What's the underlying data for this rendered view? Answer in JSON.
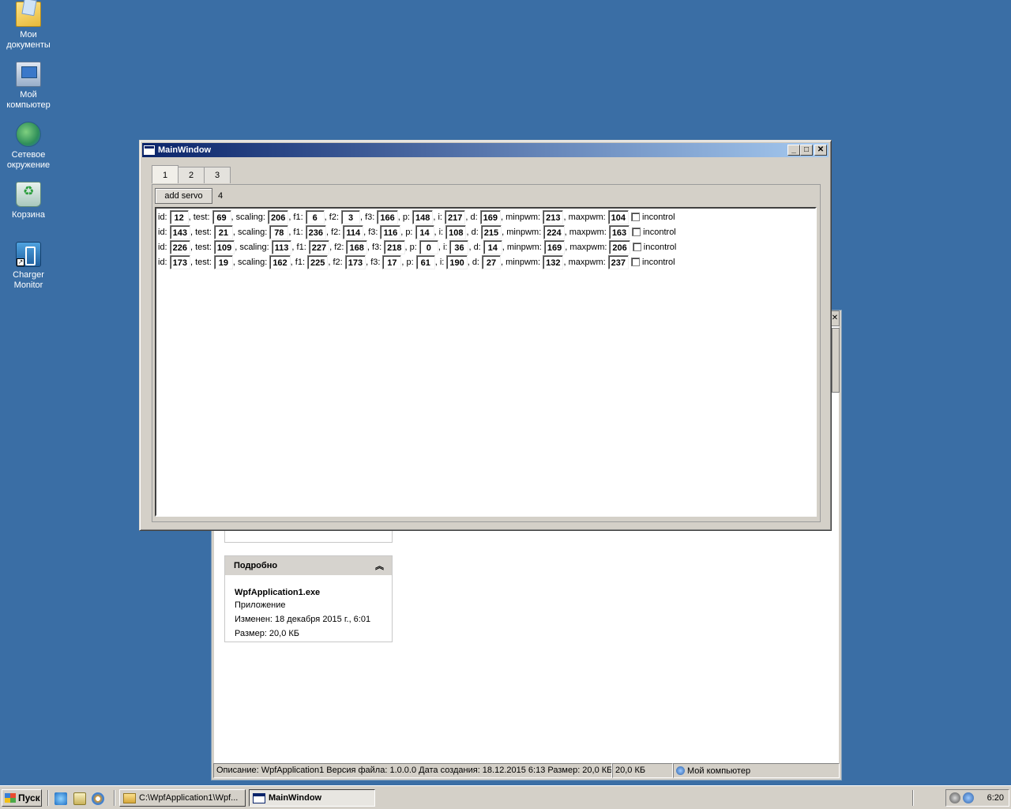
{
  "desktop": {
    "icons": [
      {
        "label": "Мои документы",
        "icon": "my-documents-icon"
      },
      {
        "label": "Мой компьютер",
        "icon": "my-computer-icon"
      },
      {
        "label": "Сетевое окружение",
        "icon": "network-icon"
      },
      {
        "label": "Корзина",
        "icon": "recycle-bin-icon"
      },
      {
        "label": "Charger Monitor",
        "icon": "charger-monitor-icon"
      }
    ]
  },
  "explorer": {
    "details": {
      "header": "Подробно",
      "filename": "WpfApplication1.exe",
      "type": "Приложение",
      "modified": "Изменен: 18 декабря 2015 г., 6:01",
      "size": "Размер: 20,0 КБ"
    },
    "status": {
      "description": "Описание: WpfApplication1 Версия файла: 1.0.0.0 Дата создания: 18.12.2015 6:13 Размер: 20,0 КБ",
      "size": "20,0 КБ",
      "location": "Мой компьютер"
    }
  },
  "mainwindow": {
    "title": "MainWindow",
    "tabs": [
      "1",
      "2",
      "3"
    ],
    "add_button": "add servo",
    "count": "4",
    "labels": {
      "id": "id:",
      "test": ", test:",
      "scaling": ", scaling:",
      "f1": ", f1:",
      "f2": ", f2:",
      "f3": ", f3:",
      "p": ", p:",
      "i": ", i:",
      "d": ", d:",
      "minpwm": ", minpwm:",
      "maxpwm": ", maxpwm:",
      "incontrol": "incontrol"
    },
    "servos": [
      {
        "id": "12",
        "test": "69",
        "scaling": "206",
        "f1": "6",
        "f2": "3",
        "f3": "166",
        "p": "148",
        "i": "217",
        "d": "169",
        "minpwm": "213",
        "maxpwm": "104",
        "incontrol": false
      },
      {
        "id": "143",
        "test": "21",
        "scaling": "78",
        "f1": "236",
        "f2": "114",
        "f3": "116",
        "p": "14",
        "i": "108",
        "d": "215",
        "minpwm": "224",
        "maxpwm": "163",
        "incontrol": false
      },
      {
        "id": "226",
        "test": "109",
        "scaling": "113",
        "f1": "227",
        "f2": "168",
        "f3": "218",
        "p": "0",
        "i": "36",
        "d": "14",
        "minpwm": "169",
        "maxpwm": "206",
        "incontrol": false
      },
      {
        "id": "173",
        "test": "19",
        "scaling": "162",
        "f1": "225",
        "f2": "173",
        "f3": "17",
        "p": "61",
        "i": "190",
        "d": "27",
        "minpwm": "132",
        "maxpwm": "237",
        "incontrol": false
      }
    ]
  },
  "taskbar": {
    "start": "Пуск",
    "tasks": [
      {
        "label": "C:\\WpfApplication1\\Wpf...",
        "active": false
      },
      {
        "label": "MainWindow",
        "active": true
      }
    ],
    "clock": "6:20"
  }
}
